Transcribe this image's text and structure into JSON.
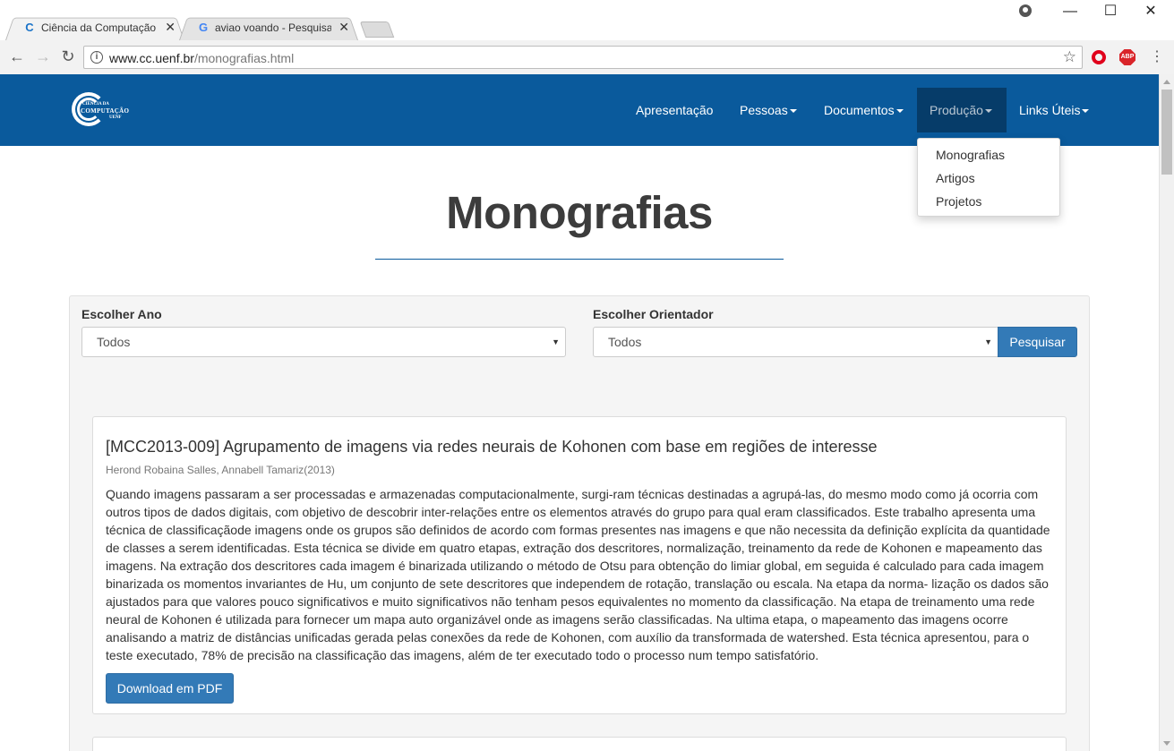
{
  "browser": {
    "tabs": [
      {
        "title": "Ciência da Computação -",
        "favicon": "C",
        "active": true
      },
      {
        "title": "aviao voando - Pesquisa",
        "favicon": "G",
        "active": false
      }
    ],
    "url_host": "www.cc.uenf.br",
    "url_path": "/monografias.html",
    "extensions": [
      "opera-icon",
      "adblock-plus-icon"
    ],
    "abp_label": "ABP",
    "window_controls": {
      "minimize": "—",
      "maximize": "☐",
      "close": "✕"
    }
  },
  "site": {
    "logo": {
      "line1": "CIÊNCIA DA",
      "line2": "COMPUTAÇÃO",
      "line3": "UENF"
    },
    "nav": [
      {
        "label": "Apresentação",
        "has_caret": false
      },
      {
        "label": "Pessoas",
        "has_caret": true
      },
      {
        "label": "Documentos",
        "has_caret": true
      },
      {
        "label": "Produção",
        "has_caret": true,
        "active": true
      },
      {
        "label": "Links Úteis",
        "has_caret": true
      }
    ],
    "dropdown": [
      "Monografias",
      "Artigos",
      "Projetos"
    ],
    "accent_color": "#0a5a9c"
  },
  "page": {
    "title": "Monografias"
  },
  "filters": {
    "year_label": "Escolher Ano",
    "year_value": "Todos",
    "advisor_label": "Escolher Orientador",
    "advisor_value": "Todos",
    "search_button": "Pesquisar"
  },
  "monografias": [
    {
      "title": "[MCC2013-009] Agrupamento de imagens via redes neurais de Kohonen com base em regiões de interesse",
      "authors": "Herond Robaina Salles, Annabell Tamariz(2013)",
      "abstract": "Quando imagens passaram a ser processadas e armazenadas computacionalmente, surgi-ram técnicas destinadas a agrupá-las, do mesmo modo como já ocorria com outros tipos de dados digitais, com objetivo de descobrir inter-relações entre os elementos através do grupo para qual eram classificados. Este trabalho apresenta uma técnica de classificaçãode imagens onde os grupos são definidos de acordo com formas presentes nas imagens e que não necessita da definição explícita da quantidade de classes a serem identificadas. Esta técnica se divide em quatro etapas, extração dos descritores, normalização, treinamento da rede de Kohonen e mapeamento das imagens. Na extração dos descritores cada imagem é binarizada utilizando o método de Otsu para obtenção do limiar global, em seguida é calculado para cada imagem binarizada os momentos invariantes de Hu, um conjunto de sete descritores que independem de rotação, translação ou escala. Na etapa da norma- lização os dados são ajustados para que valores pouco significativos e muito significativos não tenham pesos equivalentes no momento da classificação. Na etapa de treinamento uma rede neural de Kohonen é utilizada para fornecer um mapa auto organizável onde as imagens serão classificadas. Na ultima etapa, o mapeamento das imagens ocorre analisando a matriz de distâncias unificadas gerada pelas conexões da rede de Kohonen, com auxílio da transformada de watershed. Esta técnica apresentou, para o teste executado, 78% de precisão na classificação das imagens, além de ter executado todo o processo num tempo satisfatório.",
      "button": "Download em PDF"
    }
  ]
}
